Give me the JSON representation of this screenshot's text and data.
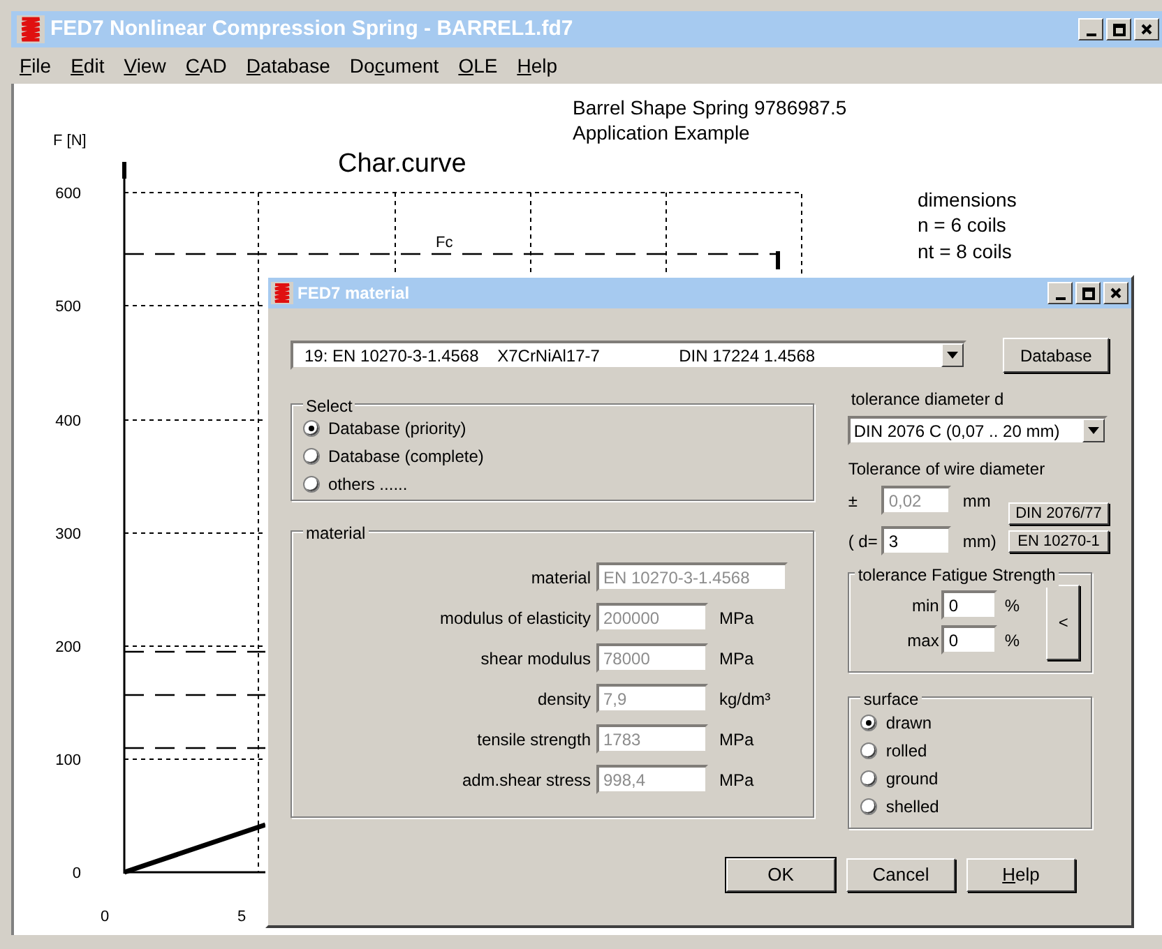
{
  "window": {
    "title": "FED7  Nonlinear Compression Spring  -  BARREL1.fd7"
  },
  "menu": [
    {
      "mnemonic": "F",
      "rest": "ile"
    },
    {
      "mnemonic": "E",
      "rest": "dit"
    },
    {
      "mnemonic": "V",
      "rest": "iew"
    },
    {
      "mnemonic": "C",
      "rest": "AD"
    },
    {
      "mnemonic": "D",
      "rest": "atabase"
    },
    {
      "before": "Do",
      "mnemonic": "c",
      "rest": "ument"
    },
    {
      "mnemonic": "O",
      "rest": "LE"
    },
    {
      "mnemonic": "H",
      "rest": "elp"
    }
  ],
  "header_lines": [
    "Barrel Shape Spring  9786987.5",
    "Application Example"
  ],
  "dimensions": {
    "title": "dimensions",
    "lines": [
      "n  = 6 coils",
      "nt = 8 coils"
    ]
  },
  "chart": {
    "title": "Char.curve",
    "ylabel": "F [N]",
    "yticks": [
      "600",
      "500",
      "400",
      "300",
      "200",
      "100",
      "0"
    ],
    "xticks": [
      "0",
      "5"
    ],
    "force_label": "Fc"
  },
  "dialog": {
    "title": "FED7 material",
    "material_combo": "19: EN 10270-3-1.4568    X7CrNiAl17-7                 DIN 17224 1.4568",
    "database_button": "Database",
    "select": {
      "title": "Select",
      "options": [
        {
          "label": "Database (priority)",
          "selected": true
        },
        {
          "label": "Database (complete)",
          "selected": false
        },
        {
          "label": "others ......",
          "selected": false
        }
      ]
    },
    "material": {
      "title": "material",
      "fields": [
        {
          "label": "material",
          "value": "EN 10270-3-1.4568",
          "disabled": true
        },
        {
          "label": "modulus of elasticity",
          "value": "200000",
          "unit": "MPa",
          "disabled": true
        },
        {
          "label": "shear modulus",
          "value": "78000",
          "unit": "MPa",
          "disabled": true
        },
        {
          "label": "density",
          "value": "7,9",
          "unit": "kg/dm³",
          "disabled": true
        },
        {
          "label": "tensile strength",
          "value": "1783",
          "unit": "MPa",
          "disabled": true
        },
        {
          "label": "adm.shear stress",
          "value": "998,4",
          "unit": "MPa",
          "disabled": true
        }
      ]
    },
    "tolerance": {
      "label": "tolerance diameter d",
      "combo": "DIN 2076 C (0,07 .. 20 mm)",
      "wire_title": "Tolerance of wire diameter",
      "plus_minus": "±",
      "tol_value": "0,02",
      "tol_disabled": true,
      "tol_unit": "mm",
      "d_label": "( d=",
      "d_value": "3",
      "d_disabled": false,
      "d_unit": "mm)",
      "buttons": [
        "DIN 2076/77",
        "EN 10270-1"
      ]
    },
    "fatigue": {
      "title": "tolerance Fatigue Strength",
      "rows": [
        {
          "label": "min",
          "value": "0",
          "unit": "%"
        },
        {
          "label": "max",
          "value": "0",
          "unit": "%"
        }
      ],
      "button": "<"
    },
    "surface": {
      "title": "surface",
      "options": [
        {
          "label": "drawn",
          "selected": true
        },
        {
          "label": "rolled",
          "selected": false
        },
        {
          "label": "ground",
          "selected": false
        },
        {
          "label": "shelled",
          "selected": false
        }
      ]
    },
    "buttons": [
      {
        "label": "OK",
        "default": true
      },
      {
        "label": "Cancel",
        "default": false
      },
      {
        "mnemonic": "H",
        "rest": "elp",
        "default": false
      }
    ]
  }
}
